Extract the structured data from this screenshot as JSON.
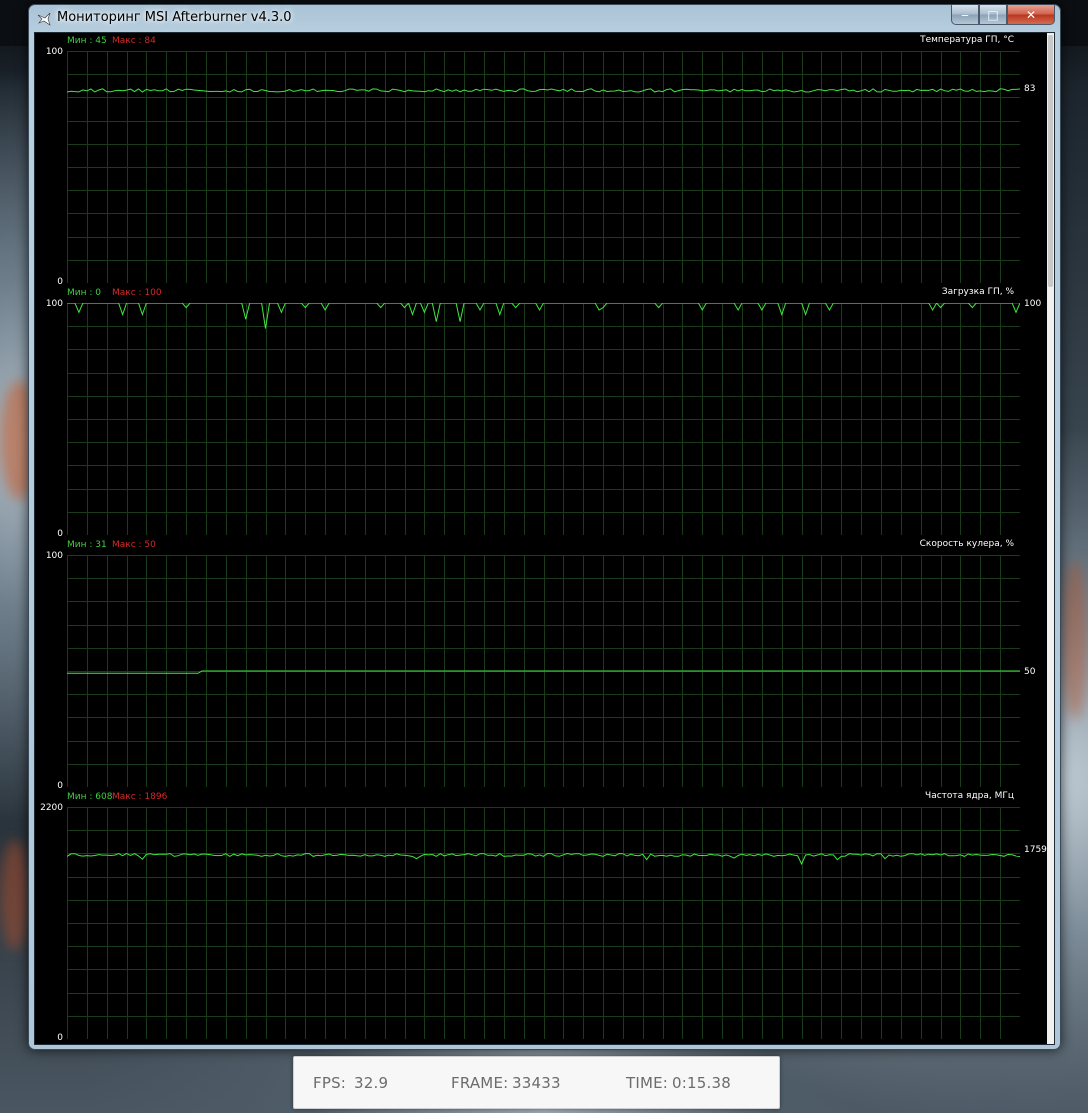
{
  "window": {
    "title": "Мониторинг MSI Afterburner v4.3.0",
    "buttons": {
      "minimize": "‒",
      "maximize": "□",
      "close": "✕"
    }
  },
  "graphs": [
    {
      "title": "Температура ГП, °C",
      "min_label": "Мин : 45",
      "max_label": "Макс : 84",
      "y_top": "100",
      "y_bottom": "0",
      "current": "83",
      "range": [
        0,
        100
      ],
      "baseline": 83,
      "noise": 0.7,
      "spikes": [],
      "step": null,
      "line_color": "#3fe83f"
    },
    {
      "title": "Загрузка ГП, %",
      "min_label": "Мин : 0",
      "max_label": "Макс : 100",
      "y_top": "100",
      "y_bottom": "0",
      "current": "100",
      "range": [
        0,
        100
      ],
      "baseline": 100,
      "noise": 0,
      "spikes": [
        [
          0.014,
          4
        ],
        [
          0.057,
          9
        ],
        [
          0.06,
          5
        ],
        [
          0.081,
          5
        ],
        [
          0.124,
          2
        ],
        [
          0.186,
          7
        ],
        [
          0.207,
          11
        ],
        [
          0.224,
          4
        ],
        [
          0.25,
          2
        ],
        [
          0.271,
          3
        ],
        [
          0.331,
          2
        ],
        [
          0.353,
          2
        ],
        [
          0.364,
          5
        ],
        [
          0.374,
          4
        ],
        [
          0.386,
          8
        ],
        [
          0.414,
          8
        ],
        [
          0.434,
          3
        ],
        [
          0.453,
          5
        ],
        [
          0.47,
          2
        ],
        [
          0.494,
          3
        ],
        [
          0.558,
          3
        ],
        [
          0.563,
          2
        ],
        [
          0.62,
          2
        ],
        [
          0.666,
          3
        ],
        [
          0.706,
          3
        ],
        [
          0.728,
          3
        ],
        [
          0.748,
          5
        ],
        [
          0.774,
          5
        ],
        [
          0.8,
          3
        ],
        [
          0.907,
          3
        ],
        [
          0.915,
          2
        ],
        [
          0.95,
          2
        ],
        [
          0.997,
          4
        ]
      ],
      "step": null,
      "line_color": "#3fe83f"
    },
    {
      "title": "Скорость кулера, %",
      "min_label": "Мин : 31",
      "max_label": "Макс : 50",
      "y_top": "100",
      "y_bottom": "0",
      "current": "50",
      "range": [
        0,
        100
      ],
      "baseline": 50,
      "noise": 0,
      "spikes": [],
      "step": {
        "at": 0.14,
        "before": 49
      },
      "line_color": "#3fe83f"
    },
    {
      "title": "Частота ядра, МГц",
      "min_label": "Мин : 608",
      "max_label": "Макс : 1896",
      "y_top": "2200",
      "y_bottom": "0",
      "current": "1759",
      "range": [
        0,
        2200
      ],
      "baseline": 1745,
      "noise": 14,
      "spikes": [
        [
          0.08,
          -40
        ],
        [
          0.365,
          -35
        ],
        [
          0.61,
          -45
        ],
        [
          0.7,
          -30
        ],
        [
          0.77,
          -85
        ],
        [
          0.81,
          -45
        ],
        [
          0.86,
          -35
        ]
      ],
      "step": null,
      "line_color": "#3fe83f"
    }
  ],
  "overlay": {
    "fps_label": "FPS:",
    "fps_value": "32.9",
    "frame_label": "FRAME:",
    "frame_value": "33433",
    "time_label": "TIME:",
    "time_value": "0:15.38"
  }
}
